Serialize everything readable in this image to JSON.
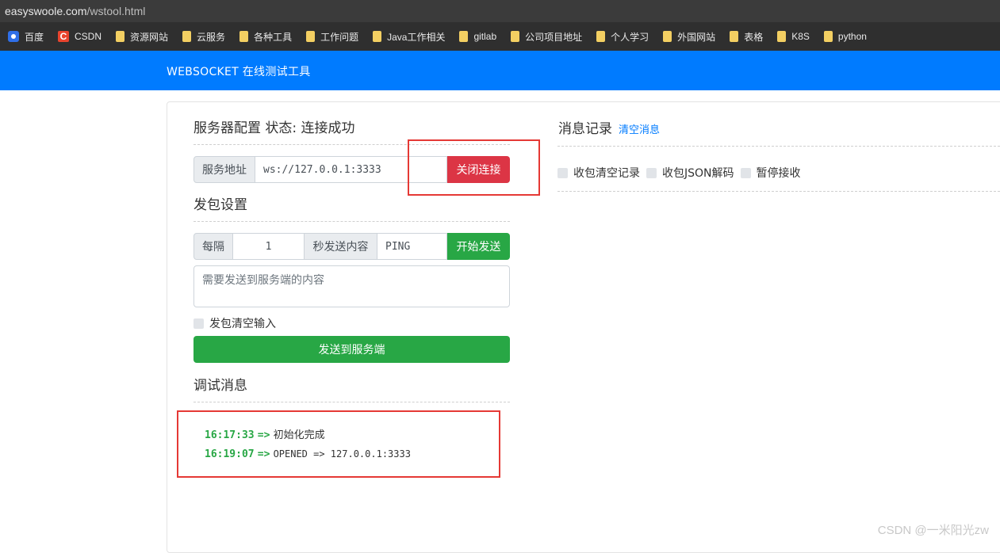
{
  "browser": {
    "url_host": "easyswoole.com",
    "url_path": "/wstool.html",
    "bookmarks": [
      {
        "label": "百度",
        "icon": "baidu-icon"
      },
      {
        "label": "CSDN",
        "icon": "csdn-icon"
      },
      {
        "label": "资源网站",
        "icon": "folder-icon"
      },
      {
        "label": "云服务",
        "icon": "folder-icon"
      },
      {
        "label": "各种工具",
        "icon": "folder-icon"
      },
      {
        "label": "工作问题",
        "icon": "folder-icon"
      },
      {
        "label": "Java工作相关",
        "icon": "folder-icon"
      },
      {
        "label": "gitlab",
        "icon": "folder-icon"
      },
      {
        "label": "公司项目地址",
        "icon": "folder-icon"
      },
      {
        "label": "个人学习",
        "icon": "folder-icon"
      },
      {
        "label": "外国网站",
        "icon": "folder-icon"
      },
      {
        "label": "表格",
        "icon": "folder-icon"
      },
      {
        "label": "K8S",
        "icon": "folder-icon"
      },
      {
        "label": "python",
        "icon": "folder-icon"
      }
    ]
  },
  "header": {
    "brand": "WEBSOCKET 在线测试工具",
    "color": "#007bff"
  },
  "server": {
    "title": "服务器配置 状态: 连接成功",
    "addr_label": "服务地址",
    "addr_value": "ws://127.0.0.1:3333",
    "close_btn": "关闭连接"
  },
  "send": {
    "title": "发包设置",
    "every_label": "每隔",
    "interval": "1",
    "content_label": "秒发送内容",
    "content_value": "PING",
    "start_btn": "开始发送",
    "textarea_placeholder": "需要发送到服务端的内容",
    "clear_input_label": "发包清空输入",
    "send_btn": "发送到服务端"
  },
  "debug": {
    "title": "调试消息",
    "logs": [
      {
        "time": "16:17:33",
        "arrow": "=>",
        "text": "初始化完成"
      },
      {
        "time": "16:19:07",
        "arrow": "=>",
        "text": "OPENED => 127.0.0.1:3333"
      }
    ]
  },
  "messages": {
    "title": "消息记录",
    "clear_link": "清空消息",
    "options": [
      "收包清空记录",
      "收包JSON解码",
      "暂停接收"
    ]
  },
  "watermark": "CSDN @一米阳光zw"
}
